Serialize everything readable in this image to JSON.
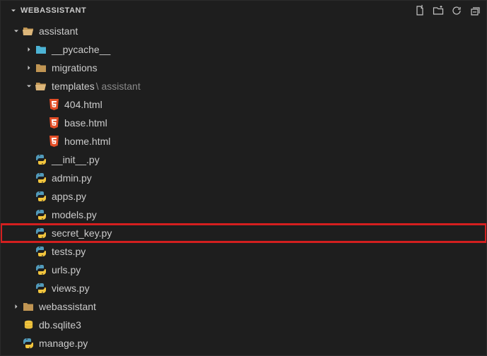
{
  "header": {
    "title": "WEBASSISTANT"
  },
  "icons": {
    "folder": "folder-icon",
    "folder_open": "folder-open-icon",
    "python": "python-icon",
    "html": "html5-icon",
    "db": "database-icon"
  },
  "colors": {
    "folder": "#c09553",
    "folder_light": "#dcb67a",
    "python": "#519aba",
    "python_accent": "#f2c53d",
    "html": "#e44d26",
    "db": "#f2c53d",
    "highlight": "#d41f1f"
  },
  "tree": [
    {
      "depth": 0,
      "twisty": "open",
      "icon": "folder_open",
      "label": "assistant",
      "interactable": true,
      "name": "folder-assistant"
    },
    {
      "depth": 1,
      "twisty": "closed",
      "icon": "folder",
      "label": "__pycache__",
      "interactable": true,
      "name": "folder-pycache",
      "icon_tint": "#4cb3d4"
    },
    {
      "depth": 1,
      "twisty": "closed",
      "icon": "folder",
      "label": "migrations",
      "interactable": true,
      "name": "folder-migrations"
    },
    {
      "depth": 1,
      "twisty": "open",
      "icon": "folder_open",
      "label": "templates",
      "suffix": " \\ assistant",
      "interactable": true,
      "name": "folder-templates"
    },
    {
      "depth": 2,
      "twisty": "none",
      "icon": "html",
      "label": "404.html",
      "interactable": true,
      "name": "file-404-html"
    },
    {
      "depth": 2,
      "twisty": "none",
      "icon": "html",
      "label": "base.html",
      "interactable": true,
      "name": "file-base-html"
    },
    {
      "depth": 2,
      "twisty": "none",
      "icon": "html",
      "label": "home.html",
      "interactable": true,
      "name": "file-home-html"
    },
    {
      "depth": 1,
      "twisty": "none",
      "icon": "python",
      "label": "__init__.py",
      "interactable": true,
      "name": "file-init-py"
    },
    {
      "depth": 1,
      "twisty": "none",
      "icon": "python",
      "label": "admin.py",
      "interactable": true,
      "name": "file-admin-py"
    },
    {
      "depth": 1,
      "twisty": "none",
      "icon": "python",
      "label": "apps.py",
      "interactable": true,
      "name": "file-apps-py"
    },
    {
      "depth": 1,
      "twisty": "none",
      "icon": "python",
      "label": "models.py",
      "interactable": true,
      "name": "file-models-py"
    },
    {
      "depth": 1,
      "twisty": "none",
      "icon": "python",
      "label": "secret_key.py",
      "interactable": true,
      "name": "file-secret-key-py",
      "highlight": true
    },
    {
      "depth": 1,
      "twisty": "none",
      "icon": "python",
      "label": "tests.py",
      "interactable": true,
      "name": "file-tests-py"
    },
    {
      "depth": 1,
      "twisty": "none",
      "icon": "python",
      "label": "urls.py",
      "interactable": true,
      "name": "file-urls-py"
    },
    {
      "depth": 1,
      "twisty": "none",
      "icon": "python",
      "label": "views.py",
      "interactable": true,
      "name": "file-views-py"
    },
    {
      "depth": 0,
      "twisty": "closed",
      "icon": "folder",
      "label": "webassistant",
      "interactable": true,
      "name": "folder-webassistant"
    },
    {
      "depth": 0,
      "twisty": "none",
      "icon": "db",
      "label": "db.sqlite3",
      "interactable": true,
      "name": "file-db-sqlite3"
    },
    {
      "depth": 0,
      "twisty": "none",
      "icon": "python",
      "label": "manage.py",
      "interactable": true,
      "name": "file-manage-py"
    }
  ]
}
